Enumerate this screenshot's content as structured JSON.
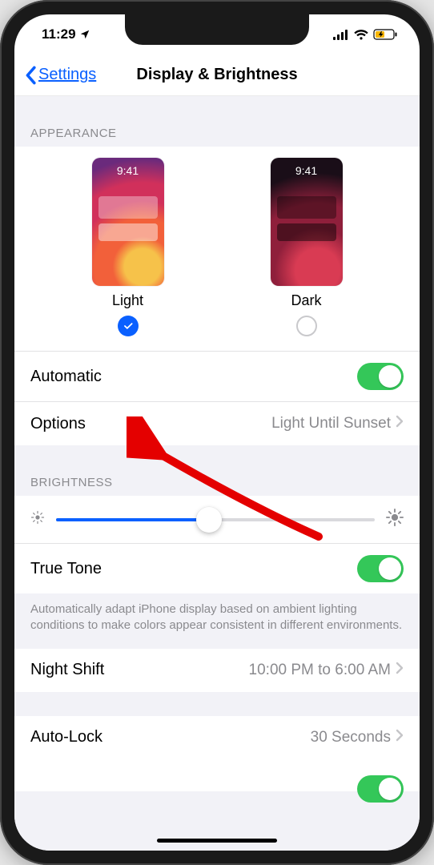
{
  "status": {
    "time": "11:29",
    "location_icon": "location-arrow"
  },
  "nav": {
    "back_label": "Settings",
    "title": "Display & Brightness"
  },
  "appearance": {
    "header": "APPEARANCE",
    "preview_time": "9:41",
    "light_label": "Light",
    "dark_label": "Dark",
    "selected": "light"
  },
  "automatic": {
    "label": "Automatic",
    "on": true
  },
  "options": {
    "label": "Options",
    "value": "Light Until Sunset"
  },
  "brightness": {
    "header": "BRIGHTNESS",
    "percent": 48
  },
  "true_tone": {
    "label": "True Tone",
    "on": true,
    "footer": "Automatically adapt iPhone display based on ambient lighting conditions to make colors appear consistent in different environments."
  },
  "night_shift": {
    "label": "Night Shift",
    "value": "10:00 PM to 6:00 AM"
  },
  "auto_lock": {
    "label": "Auto-Lock",
    "value": "30 Seconds"
  }
}
